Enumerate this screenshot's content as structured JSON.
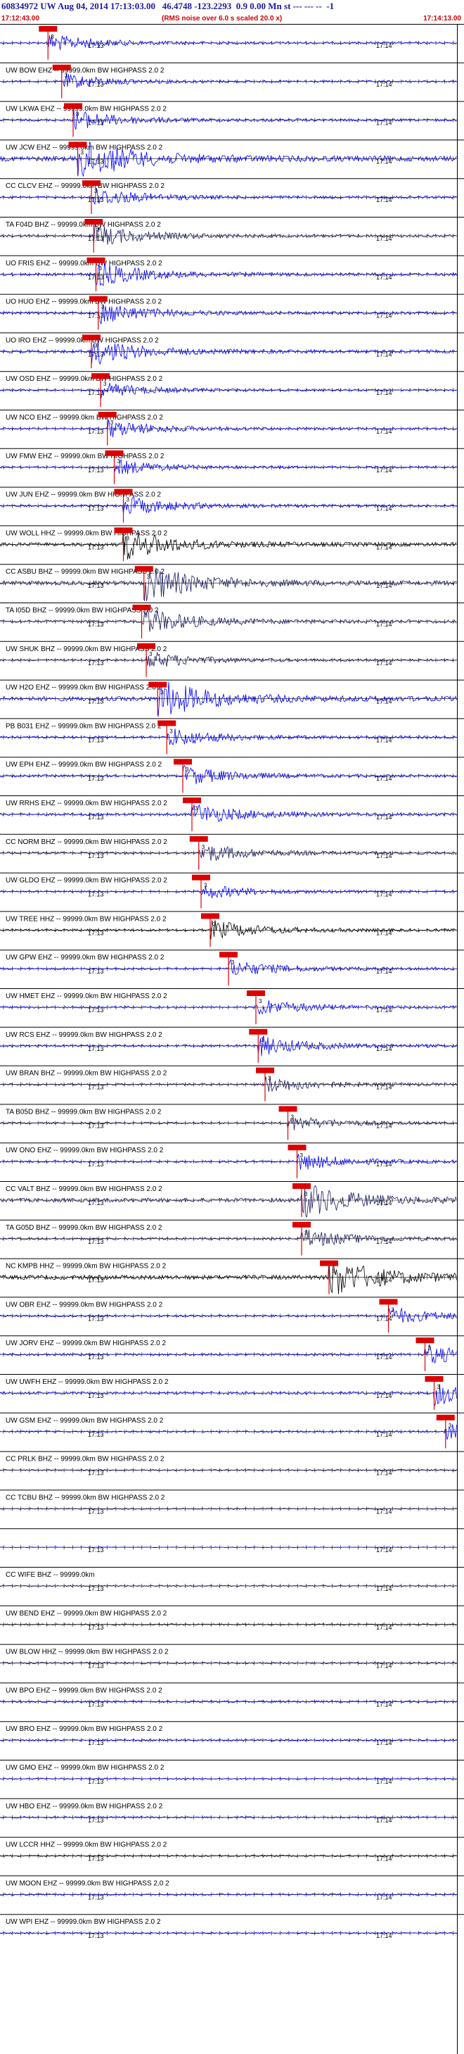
{
  "header": {
    "title": "60834972 UW Aug 04, 2014 17:13:03.00   46.4748 -123.2293  0.9 0.00 Mn st --- --- --  -1",
    "start_time": "17:12:43.00",
    "note": "(RMS noise over 6.0 s scaled 20.0 x)",
    "end_time": "17:14:13.00"
  },
  "tick_labels": [
    "17:13",
    "17:14"
  ],
  "pick_marker": "3",
  "colors": {
    "blue": "#0000ff",
    "black": "#000000",
    "navy": "#1a1a60",
    "red": "#dd0000",
    "header": "#1a1aa0"
  },
  "channels": [
    {
      "label": "",
      "color": "blue",
      "pick": 0.105,
      "amp": 0.4
    },
    {
      "label": "UW BOW EHZ -- 99999.0km BW  HIGHPASS  2.0  2",
      "color": "blue",
      "pick": 0.135,
      "amp": 0.35
    },
    {
      "label": "UW LKWA EHZ -- 99999.0km BW  HIGHPASS  2.0  2",
      "color": "blue",
      "pick": 0.16,
      "amp": 0.45
    },
    {
      "label": "UW JCW EHZ -- 99999.0km BW  HIGHPASS  2.0  2",
      "color": "blue",
      "pick": 0.17,
      "amp": 1.0
    },
    {
      "label": "CC CLCV EHZ -- 99999.0km BW  HIGHPASS  2.0  2",
      "color": "blue",
      "pick": 0.2,
      "amp": 0.45
    },
    {
      "label": "TA F04D BHZ -- 99999.0km BW  HIGHPASS  2.0  2",
      "color": "navy",
      "pick": 0.205,
      "amp": 0.5
    },
    {
      "label": "UO FRIS EHZ -- 99999.0km BW  HIGHPASS  2.0  2",
      "color": "blue",
      "pick": 0.21,
      "amp": 0.55
    },
    {
      "label": "UO HUO EHZ -- 99999.0km BW  HIGHPASS  2.0  2",
      "color": "blue",
      "pick": 0.215,
      "amp": 0.5
    },
    {
      "label": "UO IRO EHZ -- 99999.0km BW  HIGHPASS  2.0  2",
      "color": "blue",
      "pick": 0.2,
      "amp": 0.6
    },
    {
      "label": "UW OSD EHZ -- 99999.0km BW  HIGHPASS  2.0  2",
      "color": "blue",
      "pick": 0.22,
      "amp": 0.35
    },
    {
      "label": "UW NCO EHZ -- 99999.0km BW  HIGHPASS  2.0  2",
      "color": "blue",
      "pick": 0.235,
      "amp": 0.4
    },
    {
      "label": "UW FMW EHZ -- 99999.0km BW  HIGHPASS  2.0  2",
      "color": "blue",
      "pick": 0.25,
      "amp": 0.35
    },
    {
      "label": "UW JUN EHZ -- 99999.0km BW  HIGHPASS  2.0  2",
      "color": "blue",
      "pick": 0.27,
      "amp": 0.45
    },
    {
      "label": "UW WOLL HHZ -- 99999.0km BW  HIGHPASS  2.0  2",
      "color": "black",
      "pick": 0.27,
      "amp": 0.7
    },
    {
      "label": "CC ASBU BHZ -- 99999.0km BW  HIGHPASS  2.0  2",
      "color": "navy",
      "pick": 0.315,
      "amp": 0.85
    },
    {
      "label": "TA I05D BHZ -- 99999.0km BW  HIGHPASS  2.0  2",
      "color": "navy",
      "pick": 0.31,
      "amp": 0.6
    },
    {
      "label": "UW SHUK BHZ -- 99999.0km BW  HIGHPASS  2.0  2",
      "color": "navy",
      "pick": 0.32,
      "amp": 0.4
    },
    {
      "label": "UW H2O EHZ -- 99999.0km BW  HIGHPASS  2.0  2",
      "color": "blue",
      "pick": 0.345,
      "amp": 0.9
    },
    {
      "label": "PB B031 EHZ -- 99999.0km BW  HIGHPASS  2.0  2",
      "color": "blue",
      "pick": 0.365,
      "amp": 0.45
    },
    {
      "label": "UW EPH EHZ -- 99999.0km BW  HIGHPASS  2.0  2",
      "color": "blue",
      "pick": 0.4,
      "amp": 0.45
    },
    {
      "label": "UW RRHS EHZ -- 99999.0km BW  HIGHPASS  2.0  2",
      "color": "blue",
      "pick": 0.42,
      "amp": 0.5
    },
    {
      "label": "CC NORM BHZ -- 99999.0km BW  HIGHPASS  2.0  2",
      "color": "navy",
      "pick": 0.435,
      "amp": 0.45
    },
    {
      "label": "UW GLDO EHZ -- 99999.0km BW  HIGHPASS  2.0  2",
      "color": "blue",
      "pick": 0.44,
      "amp": 0.35
    },
    {
      "label": "UW TREE HHZ -- 99999.0km BW  HIGHPASS  2.0  2",
      "color": "black",
      "pick": 0.46,
      "amp": 0.45
    },
    {
      "label": "UW GPW EHZ -- 99999.0km BW  HIGHPASS  2.0  2",
      "color": "blue",
      "pick": 0.5,
      "amp": 0.4
    },
    {
      "label": "UW HMET EHZ -- 99999.0km BW  HIGHPASS  2.0  2",
      "color": "blue",
      "pick": 0.56,
      "amp": 0.4
    },
    {
      "label": "UW RCS EHZ -- 99999.0km BW  HIGHPASS  2.0  2",
      "color": "blue",
      "pick": 0.565,
      "amp": 0.45
    },
    {
      "label": "UW BRAN BHZ -- 99999.0km BW  HIGHPASS  2.0  2",
      "color": "navy",
      "pick": 0.58,
      "amp": 0.4
    },
    {
      "label": "TA B05D BHZ -- 99999.0km BW  HIGHPASS  2.0  2",
      "color": "navy",
      "pick": 0.63,
      "amp": 0.35
    },
    {
      "label": "UW ONO EHZ -- 99999.0km BW  HIGHPASS  2.0  2",
      "color": "blue",
      "pick": 0.65,
      "amp": 0.4
    },
    {
      "label": "CC VALT BHZ -- 99999.0km BW  HIGHPASS  2.0  2",
      "color": "navy",
      "pick": 0.66,
      "amp": 0.8
    },
    {
      "label": "TA G05D BHZ -- 99999.0km BW  HIGHPASS  2.0  2",
      "color": "navy",
      "pick": 0.66,
      "amp": 0.45
    },
    {
      "label": "NC KMPB HHZ -- 99999.0km BW  HIGHPASS  2.0  2",
      "color": "black",
      "pick": 0.72,
      "amp": 0.9
    },
    {
      "label": "UW OBR EHZ -- 99999.0km BW  HIGHPASS  2.0  2",
      "color": "blue",
      "pick": 0.85,
      "amp": 0.4
    },
    {
      "label": "UW JORV EHZ -- 99999.0km BW  HIGHPASS  2.0  2",
      "color": "blue",
      "pick": 0.93,
      "amp": 0.45
    },
    {
      "label": "UW UWFH EHZ -- 99999.0km BW  HIGHPASS  2.0  2",
      "color": "blue",
      "pick": 0.95,
      "amp": 0.55
    },
    {
      "label": "UW GSM EHZ -- 99999.0km BW  HIGHPASS  2.0  2",
      "color": "blue",
      "pick": 0.975,
      "amp": 0.35
    },
    {
      "label": "CC PRLK BHZ -- 99999.0km BW  HIGHPASS  2.0  2",
      "color": "navy",
      "pick": null,
      "amp": 0.3
    },
    {
      "label": "CC TCBU BHZ -- 99999.0km BW  HIGHPASS  2.0  2",
      "color": "navy",
      "pick": null,
      "amp": 0.25
    },
    {
      "label": "",
      "color": "blue",
      "pick": null,
      "amp": 0.15
    },
    {
      "label": "CC WIFE BHZ -- 99999.0km",
      "color": "navy",
      "pick": null,
      "amp": 0.3
    },
    {
      "label": "UW BEND EHZ -- 99999.0km BW  HIGHPASS  2.0  2",
      "color": "black",
      "pick": null,
      "amp": 0.3
    },
    {
      "label": "UW BLOW HHZ -- 99999.0km BW  HIGHPASS  2.0  2",
      "color": "navy",
      "pick": null,
      "amp": 0.35
    },
    {
      "label": "UW BPO EHZ -- 99999.0km BW  HIGHPASS  2.0  2",
      "color": "blue",
      "pick": null,
      "amp": 0.4
    },
    {
      "label": "UW BRO EHZ -- 99999.0km BW  HIGHPASS  2.0  2",
      "color": "blue",
      "pick": null,
      "amp": 0.4
    },
    {
      "label": "UW GMO EHZ -- 99999.0km BW  HIGHPASS  2.0  2",
      "color": "blue",
      "pick": null,
      "amp": 0.3
    },
    {
      "label": "UW HBO EHZ -- 99999.0km BW  HIGHPASS  2.0  2",
      "color": "blue",
      "pick": null,
      "amp": 0.35
    },
    {
      "label": "UW LCCR HHZ -- 99999.0km BW  HIGHPASS  2.0  2",
      "color": "black",
      "pick": null,
      "amp": 0.3
    },
    {
      "label": "UW MOON EHZ -- 99999.0km BW  HIGHPASS  2.0  2",
      "color": "blue",
      "pick": null,
      "amp": 0.35
    },
    {
      "label": "UW WPI EHZ -- 99999.0km BW  HIGHPASS  2.0  2",
      "color": "blue",
      "pick": null,
      "amp": 0.3
    }
  ]
}
